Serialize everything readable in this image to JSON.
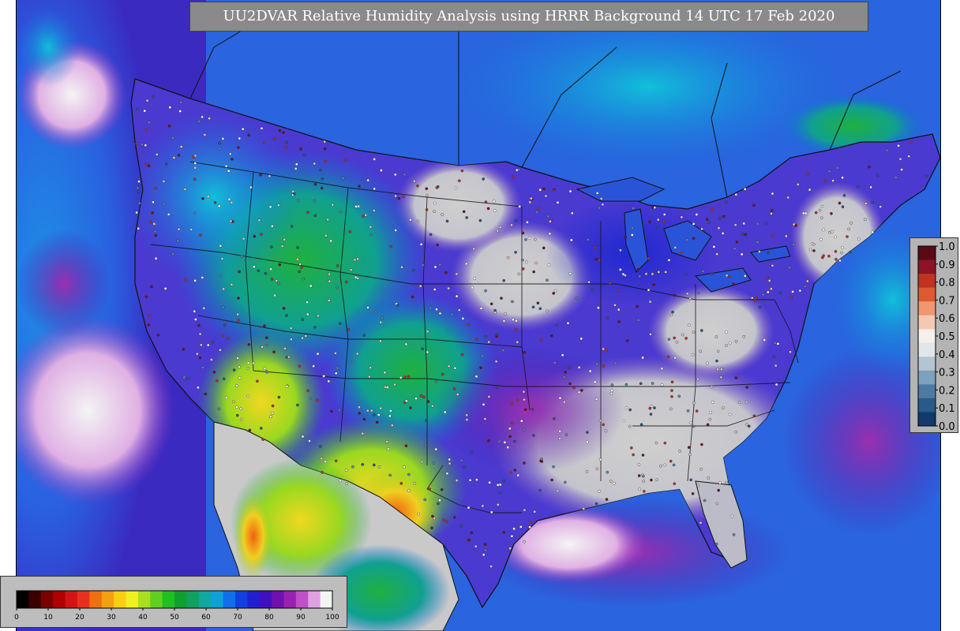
{
  "title": "UU2DVAR Relative Humidity Analysis using HRRR Background 14 UTC 17 Feb 2020",
  "colors": {
    "ocean_blue": "#2a6be0",
    "ocean_cyan": "#1ea0e6",
    "land_gray": "#c8c8c8",
    "purple": "#8a2aa6",
    "navy": "#1a1aa8",
    "green": "#20b040",
    "lime": "#58d020",
    "yellow": "#f0e020",
    "orange": "#f08c10",
    "red": "#d01818",
    "border_line": "#111111",
    "frame_gray": "#b4b4b4"
  },
  "ob_colorbar": {
    "labels": [
      "1.0",
      "0.9",
      "0.8",
      "0.7",
      "0.6",
      "0.5",
      "0.4",
      "0.3",
      "0.2",
      "0.1",
      "0.0"
    ],
    "colors": [
      "#5a0a14",
      "#8c1424",
      "#c03222",
      "#dc5a30",
      "#f09670",
      "#f5c8b4",
      "#f4f0ee",
      "#e2e6ea",
      "#b4c4d2",
      "#7ea2be",
      "#4c7aa2",
      "#2a5a8a",
      "#123a6a"
    ]
  },
  "rh_colorbar": {
    "labels": [
      "0",
      "10",
      "20",
      "30",
      "40",
      "50",
      "60",
      "70",
      "80",
      "90",
      "100"
    ],
    "colors": [
      "#000000",
      "#3a0000",
      "#7a0000",
      "#b00000",
      "#d41414",
      "#e83020",
      "#f07010",
      "#f5a010",
      "#f8d010",
      "#f0f020",
      "#a8e020",
      "#60d020",
      "#20c020",
      "#10a030",
      "#10a060",
      "#10a8a0",
      "#10a0d8",
      "#1070e8",
      "#1040e0",
      "#2020d0",
      "#4010c0",
      "#7010b0",
      "#9a20b0",
      "#c050c8",
      "#e0a0e0",
      "#f4f4f4"
    ]
  }
}
